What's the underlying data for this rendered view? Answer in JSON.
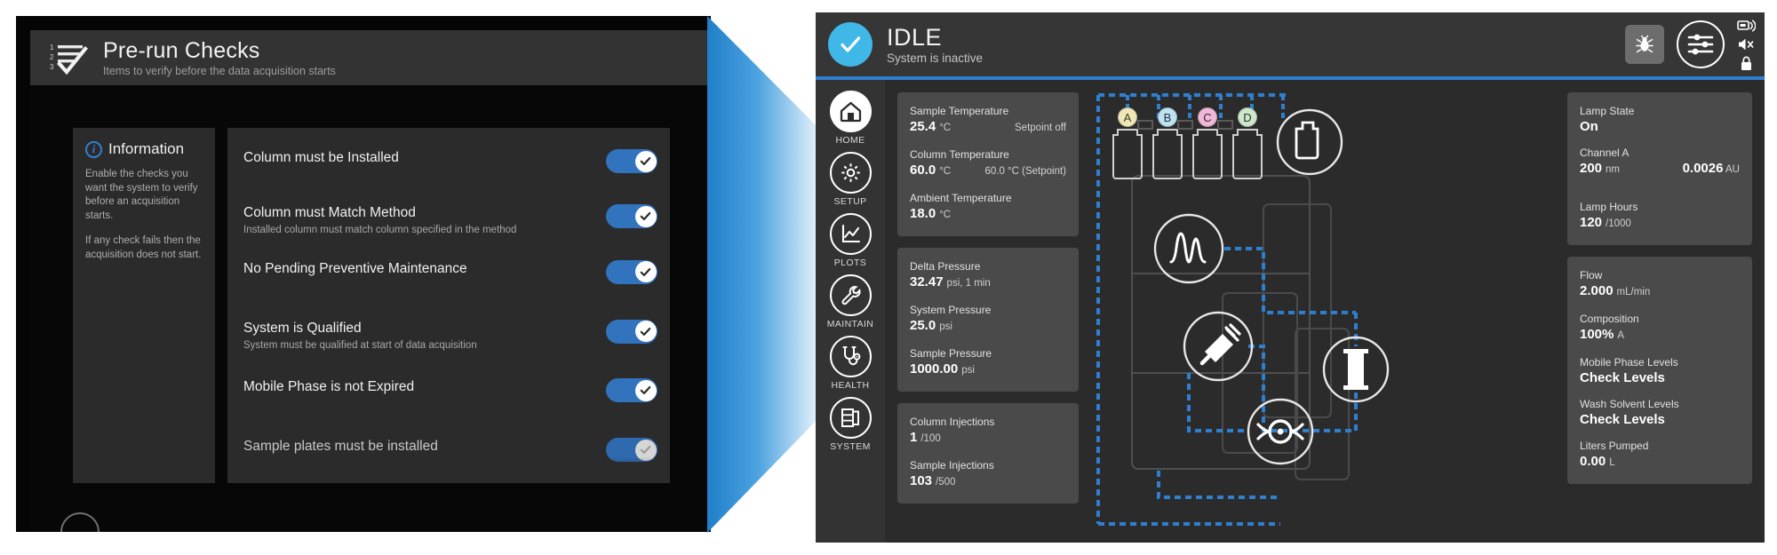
{
  "left_panel": {
    "icon": "checklist-123-icon",
    "title": "Pre-run Checks",
    "subtitle": "Items to verify before the data acquisition starts",
    "information": {
      "icon": "info-icon",
      "heading": "Information",
      "paragraphs": [
        "Enable the checks you want the system to verify before an acquisition starts.",
        "If any check fails then the acquisition does not start."
      ]
    },
    "checks": [
      {
        "label": "Column must be Installed",
        "description": "",
        "enabled": true
      },
      {
        "label": "Column must Match Method",
        "description": "Installed column must match column specified in the method",
        "enabled": true
      },
      {
        "label": "No Pending Preventive Maintenance",
        "description": "",
        "enabled": true
      },
      {
        "label": "System is Qualified",
        "description": "System must be qualified at start of data acquisition",
        "enabled": true
      },
      {
        "label": "Mobile Phase is not Expired",
        "description": "",
        "enabled": true
      },
      {
        "label": "Sample plates must be installed",
        "description": "",
        "enabled": true
      }
    ]
  },
  "right_panel": {
    "status": {
      "icon": "check-circle-icon",
      "title": "IDLE",
      "subtitle": "System is inactive"
    },
    "header_actions": {
      "bug": "bug-icon",
      "sliders": "sliders-icon",
      "broadcast": "broadcast-icon",
      "mute": "speaker-mute-icon",
      "lock": "lock-icon"
    },
    "nav": [
      {
        "label": "HOME",
        "icon": "home-icon",
        "active": true
      },
      {
        "label": "SETUP",
        "icon": "gear-icon",
        "active": false
      },
      {
        "label": "PLOTS",
        "icon": "chart-icon",
        "active": false
      },
      {
        "label": "MAINTAIN",
        "icon": "wrench-icon",
        "active": false
      },
      {
        "label": "HEALTH",
        "icon": "stethoscope-icon",
        "active": false
      },
      {
        "label": "SYSTEM",
        "icon": "system-icon",
        "active": false
      }
    ],
    "cards_left": [
      {
        "rows": [
          {
            "name": "Sample Temperature",
            "value": "25.4",
            "unit": "°C",
            "right": "Setpoint off"
          },
          {
            "name": "Column Temperature",
            "value": "60.0",
            "unit": "°C",
            "right": "60.0 °C (Setpoint)"
          },
          {
            "name": "Ambient Temperature",
            "value": "18.0",
            "unit": "°C",
            "right": ""
          }
        ]
      },
      {
        "rows": [
          {
            "name": "Delta Pressure",
            "value": "32.47",
            "unit": "psi, 1 min",
            "right": ""
          },
          {
            "name": "System Pressure",
            "value": "25.0",
            "unit": "psi",
            "right": ""
          },
          {
            "name": "Sample Pressure",
            "value": "1000.00",
            "unit": "psi",
            "right": ""
          }
        ]
      },
      {
        "rows": [
          {
            "name": "Column Injections",
            "value": "1",
            "unit": "/100",
            "right": ""
          },
          {
            "name": "Sample Injections",
            "value": "103",
            "unit": "/500",
            "right": ""
          }
        ]
      }
    ],
    "cards_right": [
      {
        "rows": [
          {
            "name": "Lamp State",
            "value": "On",
            "unit": "",
            "right": ""
          },
          {
            "name": "Channel A",
            "value": "200",
            "unit": "nm",
            "right_value": "0.0026",
            "right_unit": "AU"
          },
          {
            "name": "Lamp Hours",
            "value": "120",
            "unit": "/1000",
            "right": ""
          }
        ]
      },
      {
        "rows": [
          {
            "name": "Flow",
            "value": "2.000",
            "unit": "mL/min",
            "right": ""
          },
          {
            "name": "Composition",
            "value": "100%",
            "unit": "A",
            "right": ""
          },
          {
            "name": "Mobile Phase Levels",
            "value": "Check Levels",
            "unit": "",
            "right": ""
          },
          {
            "name": "Wash Solvent Levels",
            "value": "Check Levels",
            "unit": "",
            "right": ""
          },
          {
            "name": "Liters Pumped",
            "value": "0.00",
            "unit": "L",
            "right": ""
          }
        ]
      }
    ],
    "schematic": {
      "bottles": [
        {
          "label": "A",
          "color": "#efe7b6"
        },
        {
          "label": "B",
          "color": "#bee2f2"
        },
        {
          "label": "C",
          "color": "#f0b8d8"
        },
        {
          "label": "D",
          "color": "#cfe8cc"
        }
      ],
      "icons": [
        "waste-bottle-icon",
        "chromatogram-detector-icon",
        "syringe-injector-icon",
        "column-icon",
        "flow-cell-icon"
      ],
      "flow_path_color": "#2f7fd0"
    }
  },
  "colors": {
    "accent_blue": "#2f7fd0",
    "status_cyan": "#3fb8e8",
    "toggle_on": "#3273bd",
    "panel_bg": "#2b2b2b",
    "card_bg": "#4a4a4a",
    "nav_bg": "#333333"
  }
}
